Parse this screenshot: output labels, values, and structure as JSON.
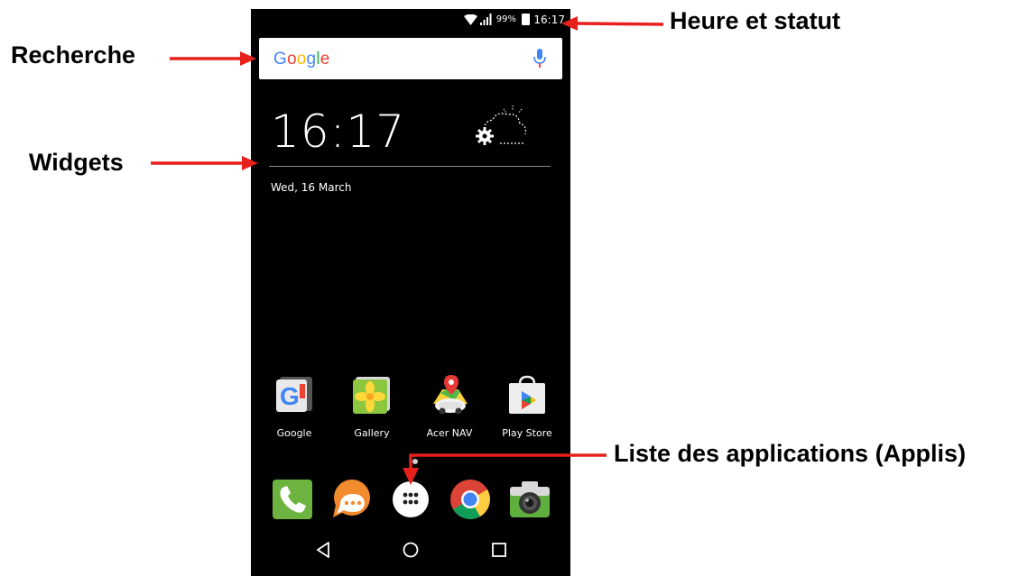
{
  "callouts": {
    "search": "Recherche",
    "widgets": "Widgets",
    "status": "Heure et statut",
    "app_list": "Liste des applications (Applis)"
  },
  "status_bar": {
    "battery_percent": "99%",
    "time": "16:17",
    "icons": [
      "wifi-icon",
      "signal-icon",
      "battery-charging-icon"
    ]
  },
  "search_bar": {
    "brand": [
      "G",
      "o",
      "o",
      "g",
      "l",
      "e"
    ],
    "brand_colors": [
      "#4285F4",
      "#EA4335",
      "#FBBC05",
      "#4285F4",
      "#34A853",
      "#EA4335"
    ],
    "mic_icon": "mic-icon"
  },
  "clock_widget": {
    "time": "16:17",
    "date": "Wed, 16 March",
    "weather_icon": "weather-settings-icon"
  },
  "home_apps": [
    {
      "label": "Google",
      "icon": "google-folder-icon"
    },
    {
      "label": "Gallery",
      "icon": "gallery-icon"
    },
    {
      "label": "Acer NAV",
      "icon": "acer-nav-icon"
    },
    {
      "label": "Play Store",
      "icon": "play-store-icon"
    }
  ],
  "dock": [
    {
      "icon": "phone-icon"
    },
    {
      "icon": "messaging-icon"
    },
    {
      "icon": "app-drawer-icon"
    },
    {
      "icon": "chrome-icon"
    },
    {
      "icon": "camera-icon"
    }
  ],
  "nav_bar": [
    "back-icon",
    "home-icon",
    "recents-icon"
  ],
  "colors": {
    "annotation_red": "#E8201C",
    "screen_bg": "#000000",
    "phone_green": "#6DB33F",
    "message_orange": "#F28B2E"
  }
}
